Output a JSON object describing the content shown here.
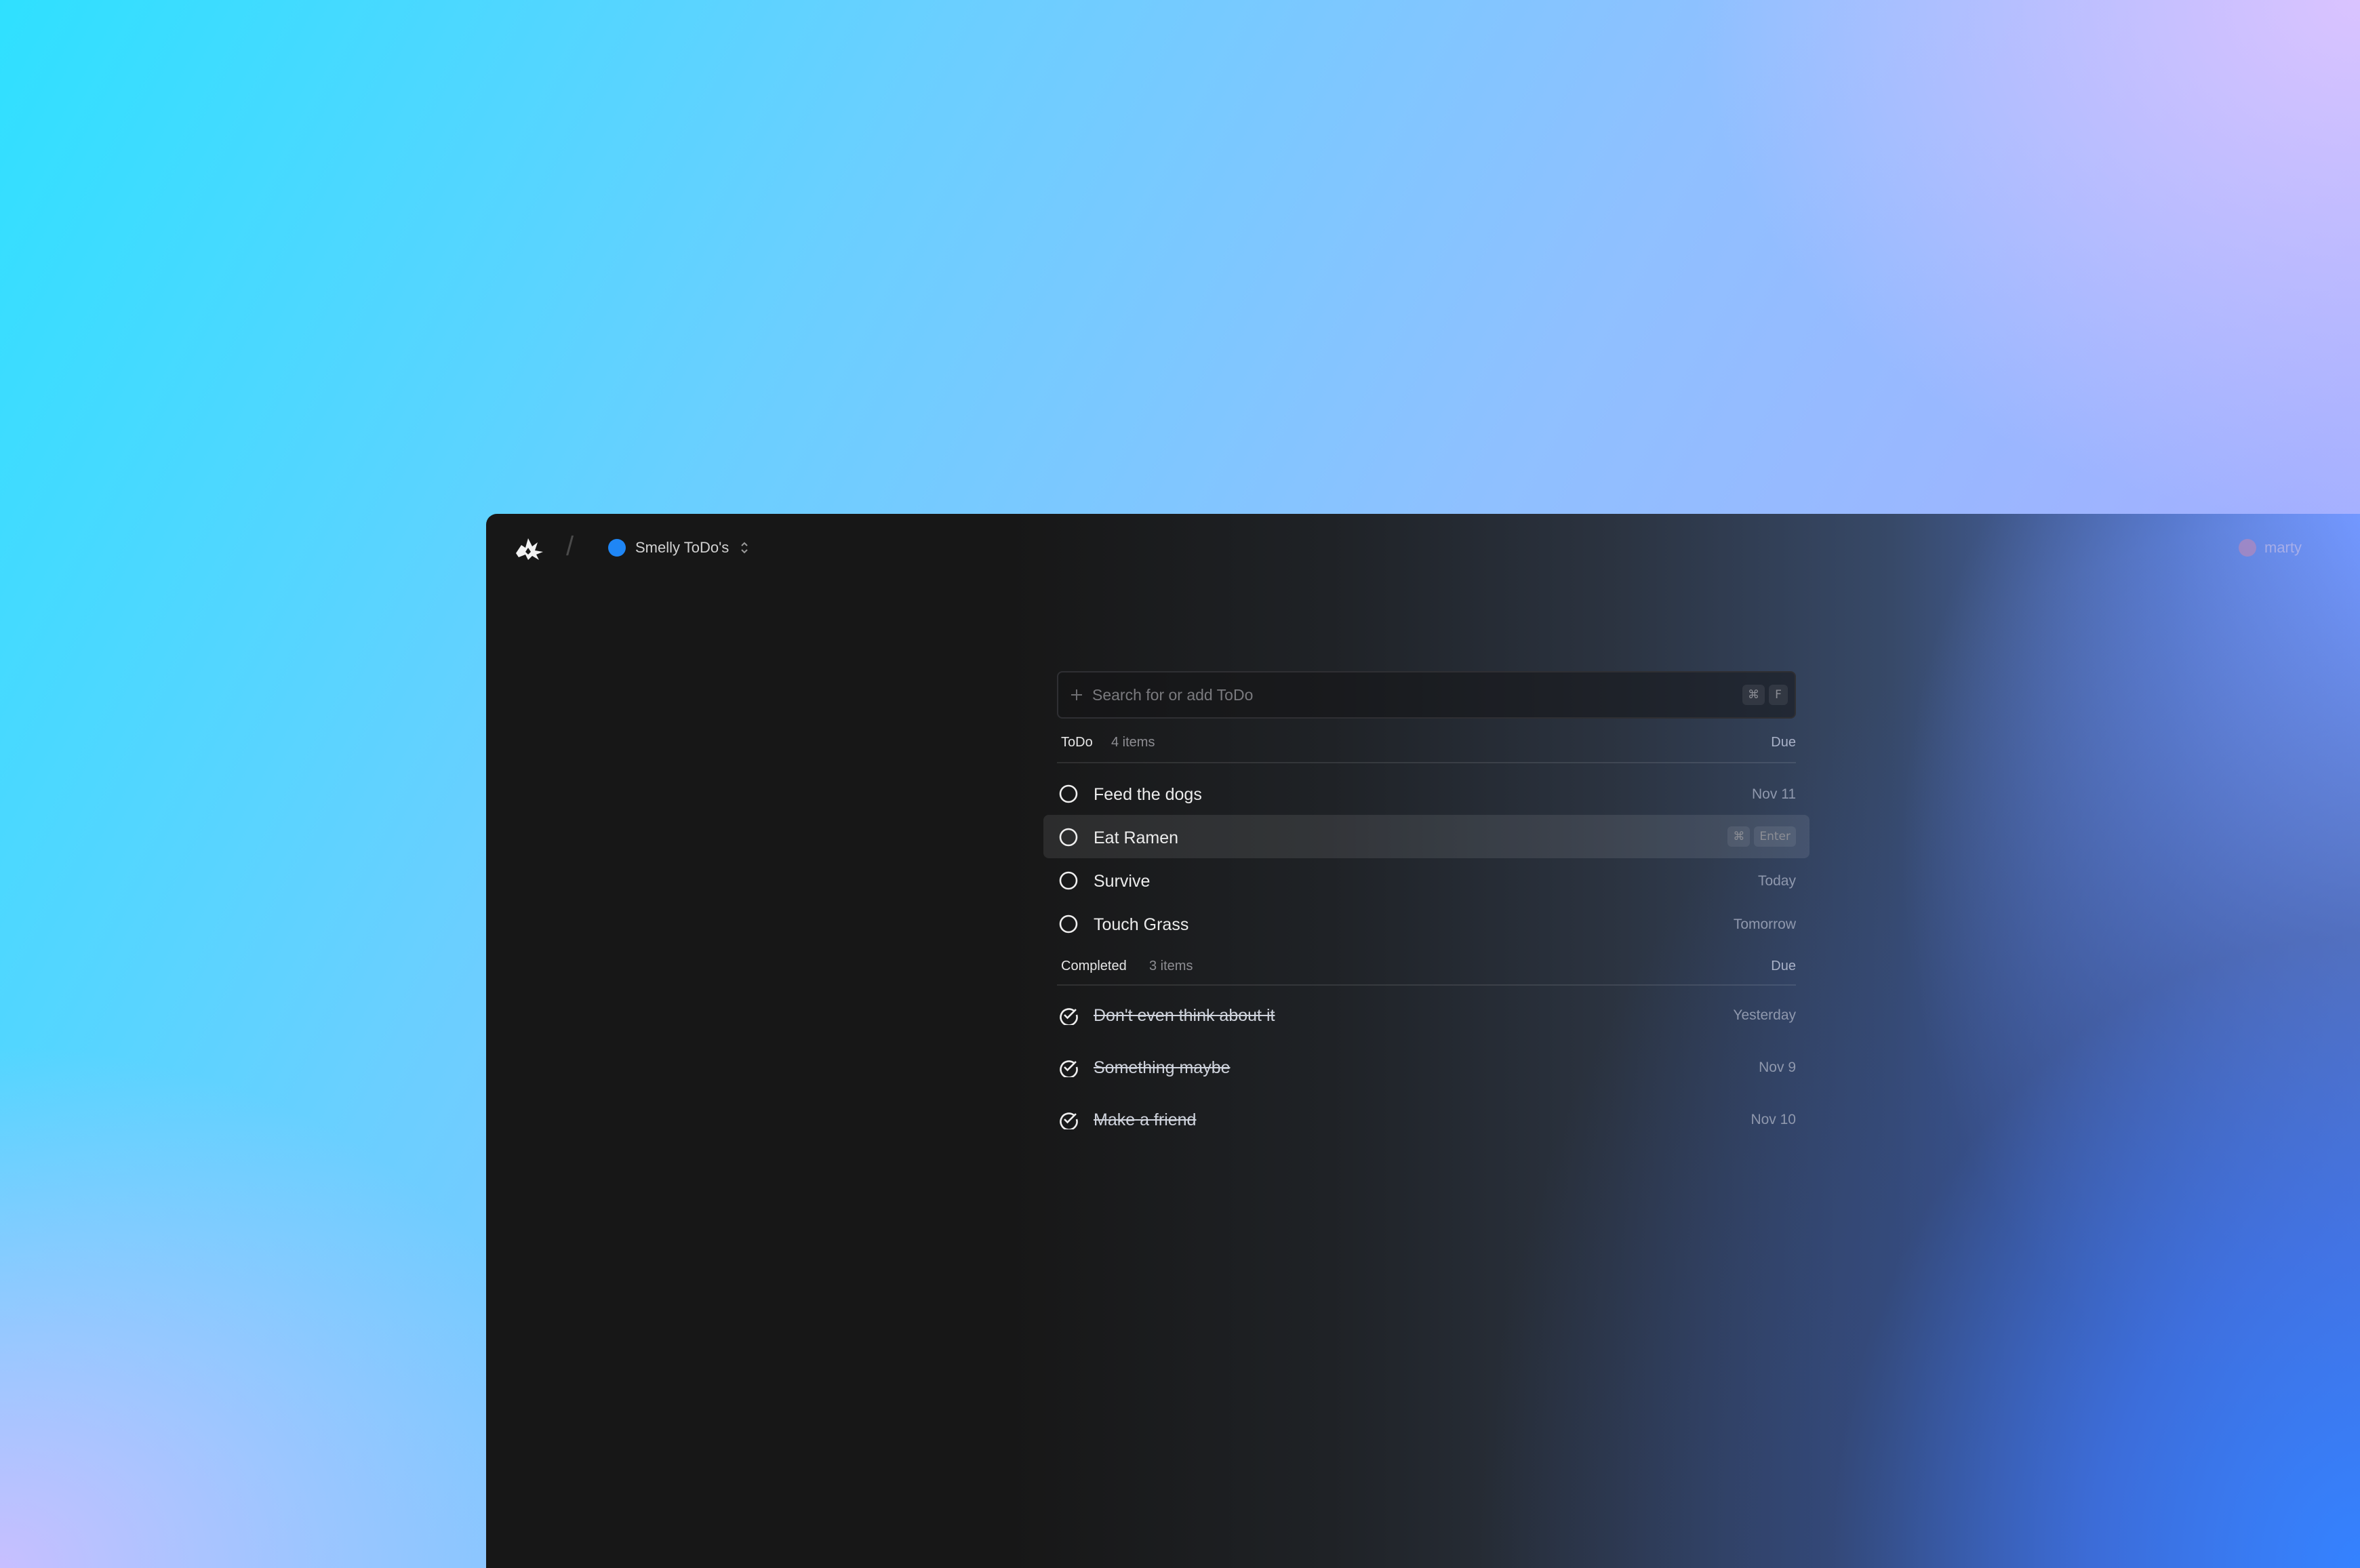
{
  "header": {
    "project_name": "Smelly ToDo's",
    "user_name": "marty"
  },
  "search": {
    "placeholder": "Search for or add ToDo",
    "shortcut_keys": [
      "⌘",
      "F"
    ]
  },
  "todo": {
    "title": "ToDo",
    "count": "4 items",
    "due_label": "Due",
    "items": [
      {
        "label": "Feed the dogs",
        "due": "Nov 11"
      },
      {
        "label": "Eat Ramen",
        "due": "",
        "shortcut": [
          "⌘",
          "Enter"
        ]
      },
      {
        "label": "Survive",
        "due": "Today"
      },
      {
        "label": "Touch Grass",
        "due": "Tomorrow"
      }
    ]
  },
  "completed": {
    "title": "Completed",
    "count": "3 items",
    "due_label": "Due",
    "items": [
      {
        "label": "Don't even think about it",
        "due": "Yesterday"
      },
      {
        "label": "Something maybe",
        "due": "Nov 9"
      },
      {
        "label": "Make a friend",
        "due": "Nov 10"
      }
    ]
  },
  "colors": {
    "project_dot": "#1f86f5",
    "window_bg": "#171717",
    "accent_gradient": "#3482ff"
  }
}
